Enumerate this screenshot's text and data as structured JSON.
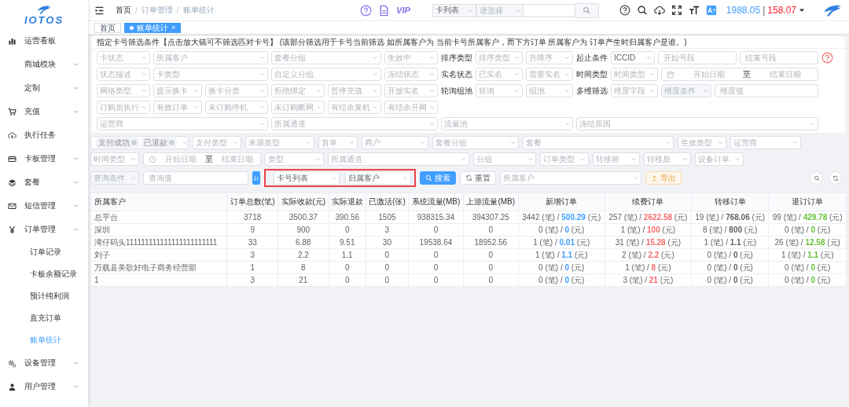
{
  "sidebar": {
    "logo": "IOTOS",
    "items": [
      {
        "label": "运营看板",
        "kind": "link"
      },
      {
        "label": "商城模块",
        "kind": "group",
        "expanded": false
      },
      {
        "label": "定制",
        "kind": "group",
        "expanded": false
      },
      {
        "label": "充值",
        "kind": "group",
        "expanded": false
      },
      {
        "label": "执行任务",
        "kind": "link"
      },
      {
        "label": "卡板管理",
        "kind": "group",
        "expanded": false
      },
      {
        "label": "套餐",
        "kind": "group",
        "expanded": false
      },
      {
        "label": "短信管理",
        "kind": "group",
        "expanded": false
      },
      {
        "label": "订单管理",
        "kind": "group",
        "expanded": true,
        "children": [
          {
            "label": "订单记录",
            "selected": false
          },
          {
            "label": "卡板余额记录",
            "selected": false
          },
          {
            "label": "预计纯利润",
            "selected": false
          },
          {
            "label": "直充订单",
            "selected": false
          },
          {
            "label": "账单统计",
            "selected": true
          }
        ]
      },
      {
        "label": "设备管理",
        "kind": "group",
        "expanded": false
      },
      {
        "label": "用户管理",
        "kind": "group",
        "expanded": false
      }
    ]
  },
  "header": {
    "breadcrumb": [
      {
        "kind": "link",
        "text": "首页"
      },
      {
        "kind": "separator",
        "text": "/"
      },
      {
        "kind": "link",
        "text": "订单管理"
      },
      {
        "kind": "separator",
        "text": "/"
      },
      {
        "kind": "current",
        "text": "账单统计"
      }
    ],
    "vip": "VIP",
    "search": [
      {
        "kind": "select",
        "value": "卡列表"
      },
      {
        "kind": "select",
        "placeholder": "请选择"
      },
      {
        "kind": "input"
      }
    ],
    "balance": "1988.05",
    "separator": "|",
    "credit": "158.07"
  },
  "tabs": [
    {
      "label": "首页",
      "selected": false
    },
    {
      "label": "账单统计",
      "selected": true,
      "close": "×"
    }
  ],
  "card_filter": {
    "title": "指定卡号筛选条件【点击放大镜可不筛选匹对卡号】 (该部分筛选用于卡号当前筛选 如所属客户为 当前卡号所属客户，而下方订单 所属客户为 订单产生时归属客户是谁。)",
    "rows": [
      {
        "fields": [
          {
            "kind": "select",
            "placeholder": "卡状态"
          },
          {
            "kind": "select",
            "placeholder": "所属客户"
          },
          {
            "kind": "select",
            "placeholder": "套餐分组"
          },
          {
            "kind": "select",
            "placeholder": "生效中"
          },
          {
            "kind": "label",
            "text": "排序类型"
          },
          {
            "kind": "select",
            "placeholder": "排序类型"
          },
          {
            "kind": "select",
            "placeholder": "升降序"
          },
          {
            "kind": "label",
            "text": "起止条件"
          },
          {
            "kind": "select",
            "value": "ICCID"
          },
          {
            "kind": "input",
            "placeholder": "开始号段"
          },
          {
            "kind": "input",
            "placeholder": "结束号段"
          },
          {
            "kind": "help"
          }
        ]
      },
      {
        "fields": [
          {
            "kind": "select",
            "placeholder": "状态描述"
          },
          {
            "kind": "select",
            "placeholder": "卡类型"
          },
          {
            "kind": "select",
            "placeholder": "自定义分组"
          },
          {
            "kind": "select",
            "placeholder": "冻结状态"
          },
          {
            "kind": "label",
            "text": "实名状态"
          },
          {
            "kind": "select",
            "placeholder": "已实名"
          },
          {
            "kind": "select",
            "placeholder": "需要实名"
          },
          {
            "kind": "label",
            "text": "时间类型"
          },
          {
            "kind": "select",
            "placeholder": "时间类型"
          },
          {
            "kind": "date-range",
            "from": {
              "placeholder": "开始日期"
            },
            "separator": "至",
            "to": {
              "placeholder": "结束日期"
            }
          }
        ]
      },
      {
        "fields": [
          {
            "kind": "select",
            "placeholder": "网络类型"
          },
          {
            "kind": "select",
            "placeholder": "提示换卡"
          },
          {
            "kind": "select",
            "placeholder": "换卡分类"
          },
          {
            "kind": "select",
            "placeholder": "拒绝绑定"
          },
          {
            "kind": "select",
            "placeholder": "暂停充值"
          },
          {
            "kind": "select",
            "placeholder": "开放实名"
          },
          {
            "kind": "label",
            "text": "轮询组池"
          },
          {
            "kind": "select",
            "placeholder": "轮询"
          },
          {
            "kind": "select",
            "placeholder": "组池"
          },
          {
            "kind": "label",
            "text": "多维筛选"
          },
          {
            "kind": "select",
            "placeholder": "维度字段"
          },
          {
            "kind": "prepend",
            "placeholder": "维度条件"
          },
          {
            "kind": "input",
            "placeholder": "维度值"
          }
        ]
      },
      {
        "fields": [
          {
            "kind": "select",
            "placeholder": "订购后执行"
          },
          {
            "kind": "select",
            "placeholder": "有效订单"
          },
          {
            "kind": "select",
            "placeholder": "未订购停机"
          },
          {
            "kind": "select",
            "placeholder": "未订购断网"
          },
          {
            "kind": "select",
            "placeholder": "有结余复机"
          },
          {
            "kind": "select",
            "placeholder": "有结余开网"
          }
        ]
      },
      {
        "fields": [
          {
            "kind": "select",
            "placeholder": "运营商"
          },
          {
            "kind": "select",
            "placeholder": "所属通道"
          },
          {
            "kind": "select",
            "placeholder": "流量池"
          },
          {
            "kind": "select",
            "placeholder": "冻结原因"
          }
        ]
      }
    ]
  },
  "order_filter": {
    "rows": [
      [
        {
          "kind": "tags",
          "tags": [
            "支付成功",
            "已退款"
          ]
        },
        {
          "kind": "select",
          "placeholder": "支付类型"
        },
        {
          "kind": "select",
          "placeholder": "来源类型"
        },
        {
          "kind": "select",
          "placeholder": "首单"
        },
        {
          "kind": "select",
          "placeholder": "商户"
        },
        {
          "kind": "select",
          "placeholder": "套餐分组"
        },
        {
          "kind": "select",
          "placeholder": "套餐"
        },
        {
          "kind": "select",
          "placeholder": "生效类型"
        },
        {
          "kind": "select",
          "placeholder": "运营商"
        }
      ],
      [
        {
          "kind": "select",
          "placeholder": "时间类型"
        },
        {
          "kind": "time-range",
          "from": {
            "placeholder": "开始日期"
          },
          "separator": "至",
          "to": {
            "placeholder": "结束日期"
          }
        },
        {
          "kind": "select",
          "placeholder": "类型"
        },
        {
          "kind": "select",
          "placeholder": "所属通道"
        },
        {
          "kind": "select",
          "placeholder": "分组"
        },
        {
          "kind": "select",
          "placeholder": "订单类型"
        },
        {
          "kind": "select",
          "placeholder": "转移前"
        },
        {
          "kind": "select",
          "placeholder": "转移后"
        },
        {
          "kind": "select",
          "placeholder": "设备订单"
        }
      ],
      [
        {
          "kind": "prepend",
          "placeholder": "查询条件"
        },
        {
          "kind": "input",
          "placeholder": "查询值"
        },
        {
          "kind": "sort-button"
        },
        {
          "kind": "group",
          "highlighted": true,
          "items": [
            {
              "kind": "select",
              "value": "卡号列表"
            },
            {
              "kind": "select",
              "value": "归属客户"
            }
          ]
        },
        {
          "kind": "primary-button",
          "label": "搜索"
        },
        {
          "kind": "button",
          "label": "重置"
        },
        {
          "kind": "select",
          "placeholder": "所属客户"
        },
        {
          "kind": "warning-button",
          "label": "导出"
        }
      ]
    ]
  },
  "table": {
    "columns": [
      {
        "label": "所属客户",
        "kind": "text"
      },
      {
        "label": "订单总数(笔)",
        "kind": "text"
      },
      {
        "label": "实际收款(元)",
        "kind": "text"
      },
      {
        "label": "实际退款",
        "kind": "text"
      },
      {
        "label": "已激活(张)",
        "kind": "text"
      },
      {
        "label": "系统流量(MB)",
        "kind": "text"
      },
      {
        "label": "上游流量(MB)",
        "kind": "text"
      },
      {
        "label": "新增订单",
        "kind": "pair",
        "color": "#409eff"
      },
      {
        "label": "续费订单",
        "kind": "pair",
        "color": "#f56c6c"
      },
      {
        "label": "转移订单",
        "kind": "pair",
        "color": "#606266"
      },
      {
        "label": "退订订单",
        "kind": "pair",
        "color": "#67c23a"
      }
    ],
    "rows": [
      [
        "总平台",
        "3718",
        "3500.37",
        "390.56",
        "1505",
        "938315.34",
        "394307.25",
        {
          "count": "3442 (笔) /",
          "amount": "500.29",
          "unit": "(元)"
        },
        {
          "count": "257 (笔) /",
          "amount": "2622.58",
          "unit": "(元)"
        },
        {
          "count": "19 (笔) /",
          "amount": "768.06",
          "unit": "(元)"
        },
        {
          "count": "99 (笔) /",
          "amount": "429.78",
          "unit": "(元)"
        }
      ],
      [
        "深圳",
        "9",
        "900",
        "0",
        "3",
        "0",
        "0",
        {
          "count": "0 (笔) /",
          "amount": "0",
          "unit": "(元)"
        },
        {
          "count": "1 (笔) /",
          "amount": "100",
          "unit": "(元)"
        },
        {
          "count": "8 (笔) /",
          "amount": "800",
          "unit": "(元)"
        },
        {
          "count": "0 (笔) /",
          "amount": "0",
          "unit": "(元)"
        }
      ],
      [
        "湾仔码头111111111111111111111111",
        "33",
        "6.88",
        "9.51",
        "30",
        "19538.64",
        "18952.56",
        {
          "count": "1 (笔) /",
          "amount": "0.01",
          "unit": "(元)"
        },
        {
          "count": "31 (笔) /",
          "amount": "15.28",
          "unit": "(元)"
        },
        {
          "count": "1 (笔) /",
          "amount": "1.1",
          "unit": "(元)"
        },
        {
          "count": "26 (笔) /",
          "amount": "12.58",
          "unit": "(元)"
        }
      ],
      [
        "刘子",
        "3",
        "2.2",
        "1.1",
        "0",
        "0",
        "0",
        {
          "count": "1 (笔) /",
          "amount": "1.1",
          "unit": "(元)"
        },
        {
          "count": "2 (笔) /",
          "amount": "2.2",
          "unit": "(元)"
        },
        {
          "count": "0 (笔) /",
          "amount": "0",
          "unit": "(元)"
        },
        {
          "count": "1 (笔) /",
          "amount": "1.1",
          "unit": "(元)"
        }
      ],
      [
        "万载县美歌好电子商务经营部",
        "1",
        "8",
        "0",
        "0",
        "0",
        "0",
        {
          "count": "0 (笔) /",
          "amount": "0",
          "unit": "(元)"
        },
        {
          "count": "1 (笔) /",
          "amount": "8",
          "unit": "(元)"
        },
        {
          "count": "0 (笔) /",
          "amount": "0",
          "unit": "(元)"
        },
        {
          "count": "0 (笔) /",
          "amount": "0",
          "unit": "(元)"
        }
      ],
      [
        "1",
        "3",
        "21",
        "0",
        "0",
        "0",
        "0",
        {
          "count": "0 (笔) /",
          "amount": "0",
          "unit": "(元)"
        },
        {
          "count": "3 (笔) /",
          "amount": "21",
          "unit": "(元)"
        },
        {
          "count": "0 (笔) /",
          "amount": "0",
          "unit": "(元)"
        },
        {
          "count": "0 (笔) /",
          "amount": "0",
          "unit": "(元)"
        }
      ]
    ]
  }
}
